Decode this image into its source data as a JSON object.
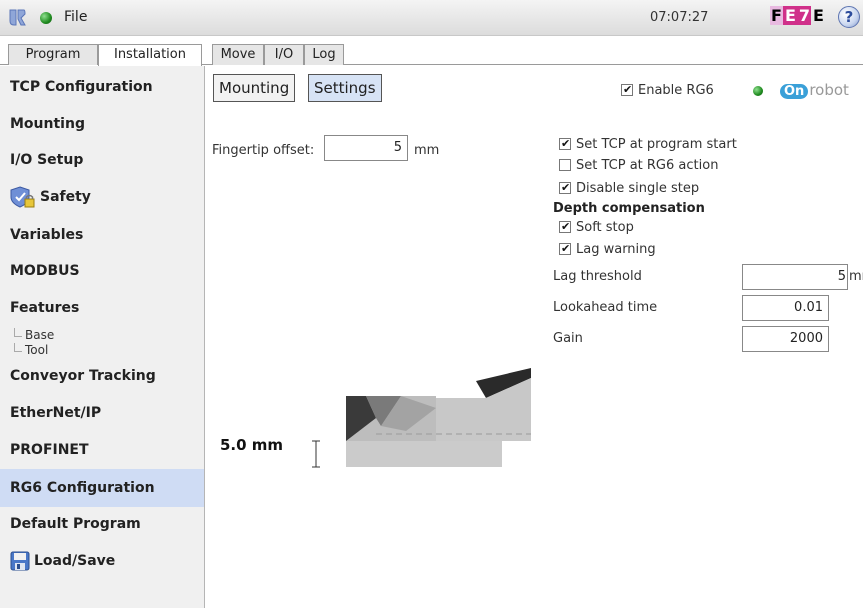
{
  "topbar": {
    "file_label": "File",
    "clock": "07:07:27",
    "hex_code": [
      "F",
      "E",
      "7",
      "E"
    ],
    "help_label": "?"
  },
  "tabs": [
    {
      "label": "Program",
      "active": false
    },
    {
      "label": "Installation",
      "active": true
    },
    {
      "label": "Move",
      "active": false
    },
    {
      "label": "I/O",
      "active": false
    },
    {
      "label": "Log",
      "active": false
    }
  ],
  "sidebar": {
    "items": [
      {
        "label": "TCP Configuration"
      },
      {
        "label": "Mounting"
      },
      {
        "label": "I/O Setup"
      },
      {
        "label": "Safety"
      },
      {
        "label": "Variables"
      },
      {
        "label": "MODBUS"
      },
      {
        "label": "Features"
      },
      {
        "label": "Conveyor Tracking"
      },
      {
        "label": "EtherNet/IP"
      },
      {
        "label": "PROFINET"
      },
      {
        "label": "RG6 Configuration",
        "active": true
      },
      {
        "label": "Default Program"
      },
      {
        "label": "Load/Save"
      }
    ],
    "features_children": [
      "Base",
      "Tool"
    ]
  },
  "main": {
    "subtabs": [
      {
        "label": "Mounting",
        "active": false
      },
      {
        "label": "Settings",
        "active": true
      }
    ],
    "enable_rg6": {
      "label": "Enable RG6",
      "checked": true
    },
    "onrobot": {
      "badge": "On",
      "text": "robot"
    },
    "fingertip": {
      "label": "Fingertip offset:",
      "value": "5",
      "unit": "mm"
    },
    "checkboxes": [
      {
        "label": "Set TCP at program start",
        "checked": true
      },
      {
        "label": "Set TCP at RG6 action",
        "checked": false
      },
      {
        "label": "Disable single step",
        "checked": true
      }
    ],
    "depth_compensation": {
      "title": "Depth compensation",
      "options": [
        {
          "label": "Soft stop",
          "checked": true
        },
        {
          "label": "Lag warning",
          "checked": true
        }
      ]
    },
    "lag_threshold": {
      "label": "Lag threshold",
      "value": "5",
      "unit": "mm"
    },
    "lookahead_time": {
      "label": "Lookahead time",
      "value": "0.01"
    },
    "gain": {
      "label": "Gain",
      "value": "2000"
    },
    "measurement": "5.0 mm"
  },
  "colors": {
    "active_sidebar": "#cfdcf4",
    "status_green": "#1f8a1f",
    "onrobot_blue": "#3aa0d8",
    "hex_magenta": "#d0308a"
  }
}
